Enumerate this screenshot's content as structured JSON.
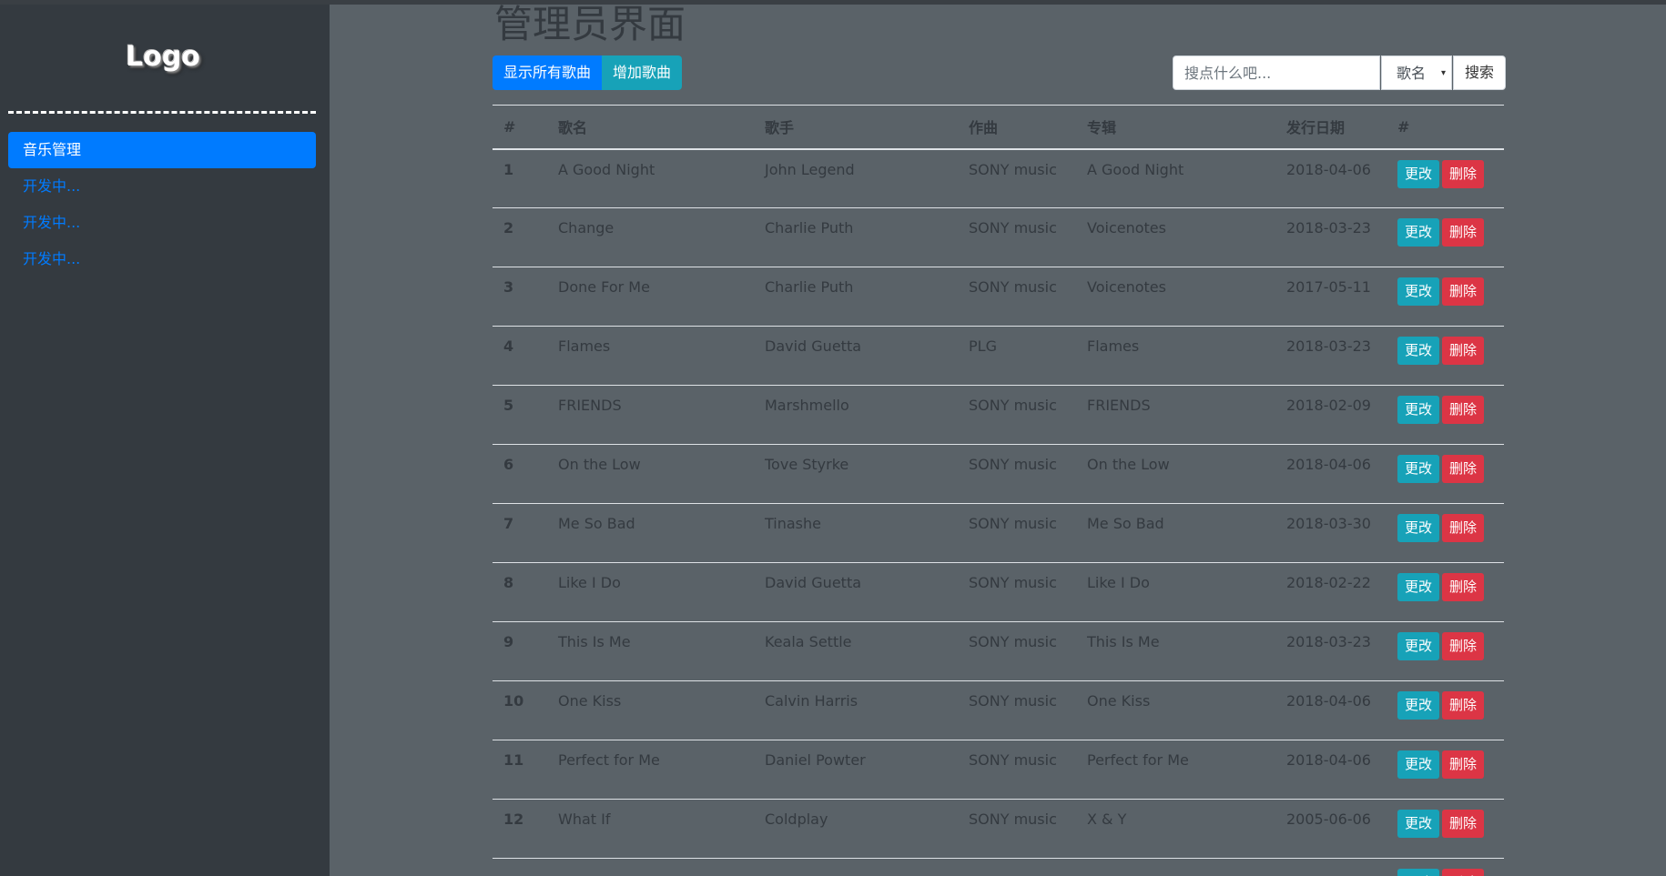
{
  "sidebar": {
    "logo": "Logo",
    "items": [
      {
        "label": "音乐管理",
        "active": true
      },
      {
        "label": "开发中..."
      },
      {
        "label": "开发中..."
      },
      {
        "label": "开发中..."
      }
    ]
  },
  "main": {
    "title": "管理员界面",
    "show_all_label": "显示所有歌曲",
    "add_label": "增加歌曲",
    "search": {
      "placeholder": "搜点什么吧...",
      "select_value": "歌名",
      "button_label": "搜索"
    },
    "table": {
      "headers": [
        "#",
        "歌名",
        "歌手",
        "作曲",
        "专辑",
        "发行日期",
        "#"
      ],
      "edit_label": "更改",
      "delete_label": "删除",
      "rows": [
        {
          "id": "1",
          "song": "A Good Night",
          "singer": "John Legend",
          "composer": "SONY music",
          "album": "A Good Night",
          "date": "2018-04-06"
        },
        {
          "id": "2",
          "song": "Change",
          "singer": "Charlie Puth",
          "composer": "SONY music",
          "album": "Voicenotes",
          "date": "2018-03-23"
        },
        {
          "id": "3",
          "song": "Done For Me",
          "singer": "Charlie Puth",
          "composer": "SONY music",
          "album": "Voicenotes",
          "date": "2017-05-11"
        },
        {
          "id": "4",
          "song": "Flames",
          "singer": "David Guetta",
          "composer": "PLG",
          "album": "Flames",
          "date": "2018-03-23"
        },
        {
          "id": "5",
          "song": "FRIENDS",
          "singer": "Marshmello",
          "composer": "SONY music",
          "album": "FRIENDS",
          "date": "2018-02-09"
        },
        {
          "id": "6",
          "song": "On the Low",
          "singer": "Tove Styrke",
          "composer": "SONY music",
          "album": "On the Low",
          "date": "2018-04-06"
        },
        {
          "id": "7",
          "song": "Me So Bad",
          "singer": "Tinashe",
          "composer": "SONY music",
          "album": "Me So Bad",
          "date": "2018-03-30"
        },
        {
          "id": "8",
          "song": "Like I Do",
          "singer": "David Guetta",
          "composer": "SONY music",
          "album": "Like I Do",
          "date": "2018-02-22"
        },
        {
          "id": "9",
          "song": "This Is Me",
          "singer": "Keala Settle",
          "composer": "SONY music",
          "album": "This Is Me",
          "date": "2018-03-23"
        },
        {
          "id": "10",
          "song": "One Kiss",
          "singer": "Calvin Harris",
          "composer": "SONY music",
          "album": "One Kiss",
          "date": "2018-04-06"
        },
        {
          "id": "11",
          "song": "Perfect for Me",
          "singer": "Daniel Powter",
          "composer": "SONY music",
          "album": "Perfect for Me",
          "date": "2018-04-06"
        },
        {
          "id": "12",
          "song": "What If",
          "singer": "Coldplay",
          "composer": "SONY music",
          "album": "X & Y",
          "date": "2005-06-06"
        },
        {
          "id": "",
          "song": "",
          "singer": "",
          "composer": "",
          "album": "",
          "date": ""
        }
      ]
    }
  }
}
